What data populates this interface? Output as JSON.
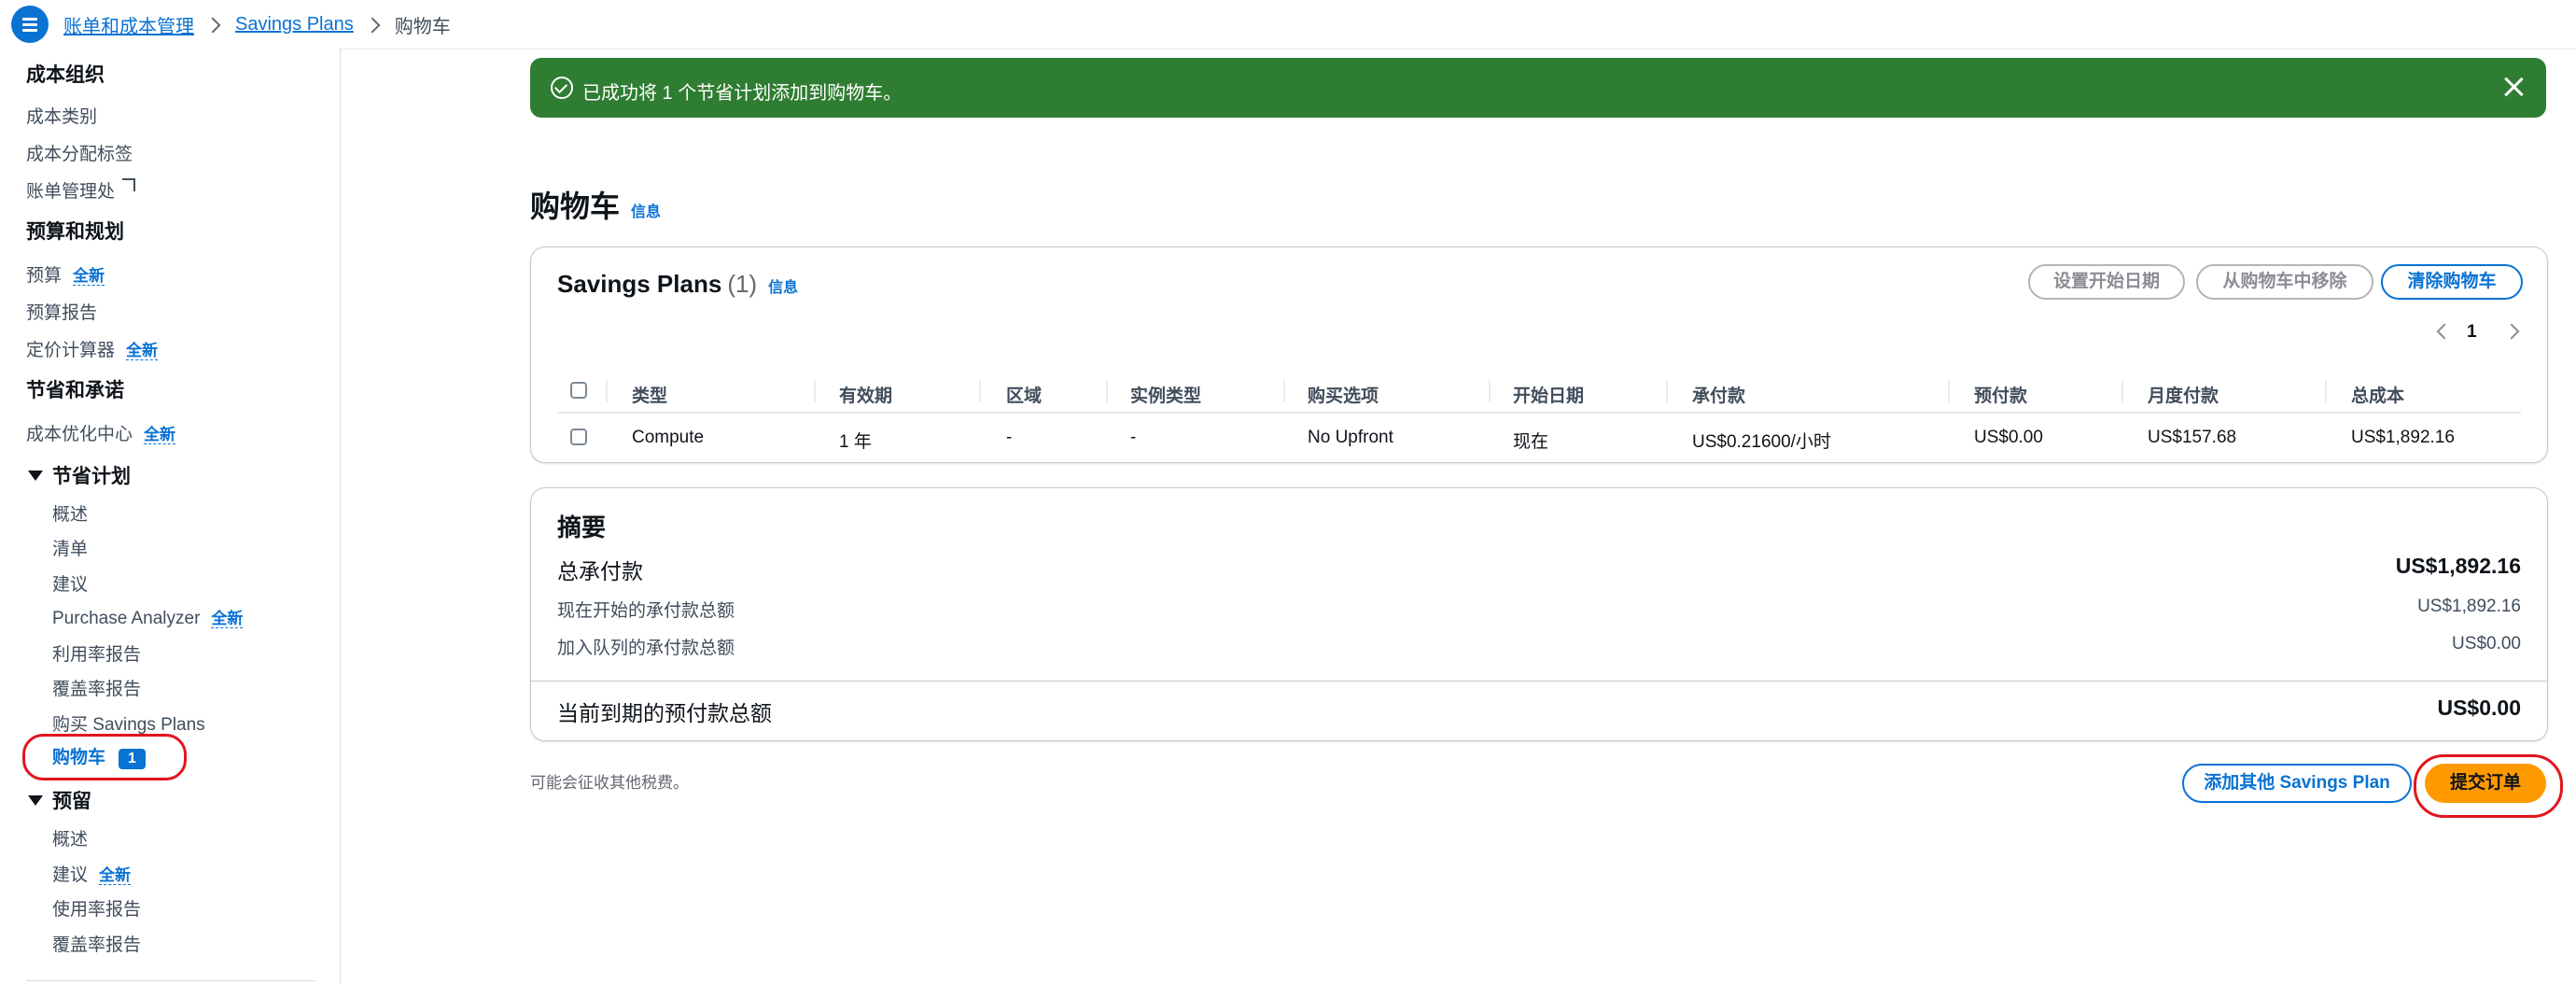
{
  "breadcrumb": {
    "items": [
      "账单和成本管理",
      "Savings Plans"
    ],
    "current": "购物车"
  },
  "sidebar": {
    "cost_org": {
      "heading": "成本组织",
      "items": [
        "成本类别",
        "成本分配标签",
        "账单管理处"
      ]
    },
    "budget": {
      "heading": "预算和规划",
      "items": [
        "预算",
        "预算报告",
        "定价计算器"
      ]
    },
    "savings": {
      "heading": "节省和承诺",
      "items": [
        "成本优化中心"
      ]
    },
    "savings_plans": {
      "heading": "节省计划",
      "items": [
        "概述",
        "清单",
        "建议",
        "Purchase Analyzer",
        "利用率报告",
        "覆盖率报告",
        "购买 Savings Plans",
        "购物车"
      ],
      "cart_badge": "1"
    },
    "reservations": {
      "heading": "预留",
      "items": [
        "概述",
        "建议",
        "使用率报告",
        "覆盖率报告"
      ]
    },
    "new_label": "全新"
  },
  "flash": {
    "message": "已成功将 1 个节省计划添加到购物车。"
  },
  "page": {
    "title": "购物车",
    "info": "信息"
  },
  "cart_card": {
    "title": "Savings Plans",
    "count": "(1)",
    "info": "信息",
    "buttons": {
      "set_start": "设置开始日期",
      "remove": "从购物车中移除",
      "clear": "清除购物车"
    },
    "page_number": "1",
    "columns": [
      "类型",
      "有效期",
      "区域",
      "实例类型",
      "购买选项",
      "开始日期",
      "承付款",
      "预付款",
      "月度付款",
      "总成本"
    ],
    "rows": [
      [
        "Compute",
        "1 年",
        "-",
        "-",
        "No Upfront",
        "现在",
        "US$0.21600/小时",
        "US$0.00",
        "US$157.68",
        "US$1,892.16"
      ]
    ]
  },
  "summary": {
    "title": "摘要",
    "total_commit_label": "总承付款",
    "total_commit_value": "US$1,892.16",
    "now_label": "现在开始的承付款总额",
    "now_value": "US$1,892.16",
    "queued_label": "加入队列的承付款总额",
    "queued_value": "US$0.00",
    "due_label": "当前到期的预付款总额",
    "due_value": "US$0.00"
  },
  "footer": {
    "tax_note": "可能会征收其他税费。",
    "add_button": "添加其他 Savings Plan",
    "submit_button": "提交订单"
  },
  "colors": {
    "accent": "#0972d3",
    "success": "#2f7d32",
    "submit": "#ff9900",
    "highlight": "#e3141c"
  }
}
